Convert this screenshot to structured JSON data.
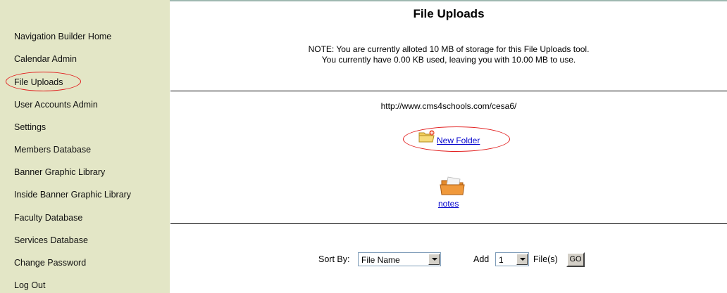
{
  "page_title": "File Uploads",
  "note": {
    "line1": "NOTE: You are currently alloted 10 MB of storage for this File Uploads tool.",
    "line2": "You currently have 0.00 KB used, leaving you with 10.00 MB to use."
  },
  "sidebar": {
    "items": [
      {
        "label": "Navigation Builder Home"
      },
      {
        "label": "Calendar Admin"
      },
      {
        "label": "File Uploads"
      },
      {
        "label": "User Accounts Admin"
      },
      {
        "label": "Settings"
      },
      {
        "label": "Members Database"
      },
      {
        "label": "Banner Graphic Library"
      },
      {
        "label": "Inside Banner Graphic Library"
      },
      {
        "label": "Faculty Database"
      },
      {
        "label": "Services Database"
      },
      {
        "label": "Change Password"
      },
      {
        "label": "Log Out"
      }
    ]
  },
  "current_path": "http://www.cms4schools.com/cesa6/",
  "new_folder_label": "New Folder",
  "folders": [
    {
      "name": "notes"
    }
  ],
  "controls": {
    "sort_by_label": "Sort By:",
    "sort_by_value": "File Name",
    "add_label": "Add",
    "add_count": "1",
    "files_label": "File(s)",
    "go_label": "GO"
  },
  "colors": {
    "sidebar_bg": "#e3e6c6",
    "highlight_oval": "#e21c1c",
    "link": "#0000cc"
  },
  "icons": [
    "new-folder-icon",
    "folder-icon",
    "dropdown-arrow-icon"
  ]
}
